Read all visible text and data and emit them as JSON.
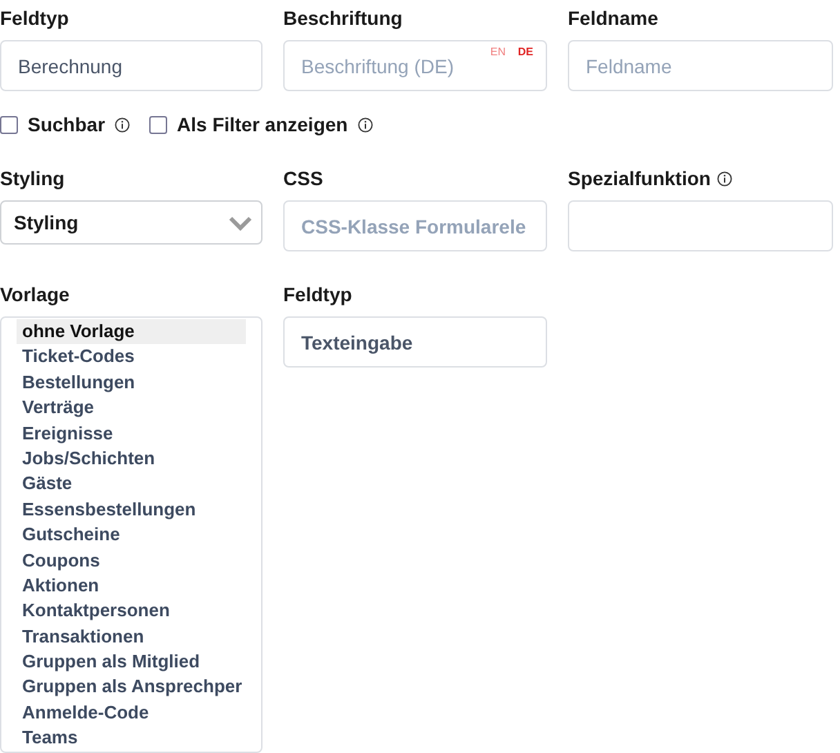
{
  "top_fields": [
    {
      "kind": "text",
      "label": "Feldtyp",
      "value": "Berechnung"
    },
    {
      "kind": "translated",
      "label": "Beschriftung",
      "placeholder": "Beschriftung (DE)",
      "languages": [
        {
          "code": "EN",
          "selected": false
        },
        {
          "code": "DE",
          "selected": true
        }
      ]
    },
    {
      "kind": "text",
      "label": "Feldname",
      "placeholder": "Feldname"
    }
  ],
  "checkboxes": [
    {
      "label": "Suchbar",
      "checked": false,
      "info": true
    },
    {
      "label": "Als Filter anzeigen",
      "checked": false,
      "info": true
    }
  ],
  "styling": {
    "label": "Styling",
    "value": "Styling"
  },
  "css": {
    "label": "CSS",
    "placeholder": "CSS-Klasse Formularele"
  },
  "special": {
    "label": "Spezialfunktion",
    "info": true
  },
  "template": {
    "label": "Vorlage",
    "options": [
      {
        "label": "ohne Vorlage",
        "selected": true
      },
      {
        "label": "Ticket-Codes",
        "selected": false
      },
      {
        "label": "Bestellungen",
        "selected": false
      },
      {
        "label": "Verträge",
        "selected": false
      },
      {
        "label": "Ereignisse",
        "selected": false
      },
      {
        "label": "Jobs/Schichten",
        "selected": false
      },
      {
        "label": "Gäste",
        "selected": false
      },
      {
        "label": "Essensbestellungen",
        "selected": false
      },
      {
        "label": "Gutscheine",
        "selected": false
      },
      {
        "label": "Coupons",
        "selected": false
      },
      {
        "label": "Aktionen",
        "selected": false
      },
      {
        "label": "Kontaktpersonen",
        "selected": false
      },
      {
        "label": "Transaktionen",
        "selected": false
      },
      {
        "label": "Gruppen als Mitglied",
        "selected": false
      },
      {
        "label": "Gruppen als Ansprechper",
        "selected": false
      },
      {
        "label": "Anmelde-Code",
        "selected": false
      },
      {
        "label": "Teams",
        "selected": false
      }
    ]
  },
  "field_type": {
    "label": "Feldtyp",
    "value": "Texteingabe"
  }
}
